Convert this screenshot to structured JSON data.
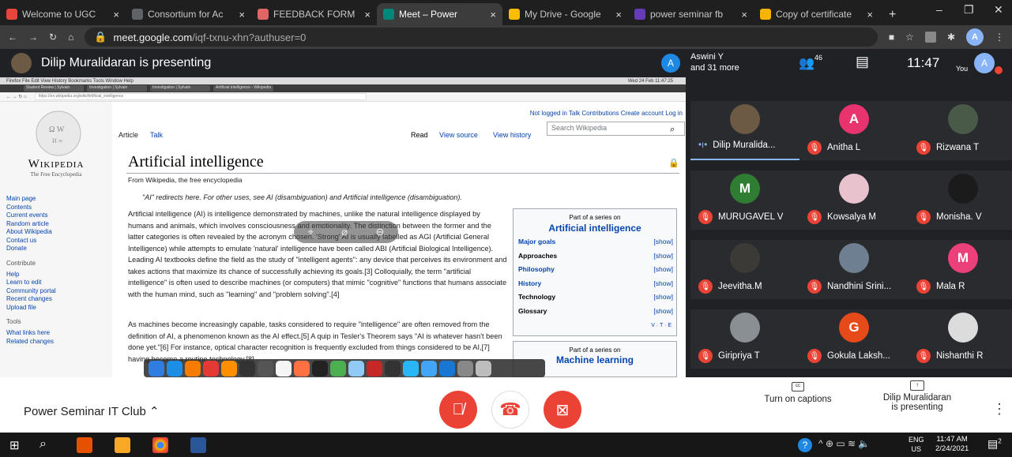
{
  "browser": {
    "tabs": [
      {
        "title": "Welcome to UGC",
        "color": "#e8453c",
        "active": false
      },
      {
        "title": "Consortium for Ac",
        "color": "#5f6368",
        "active": false
      },
      {
        "title": "FEEDBACK FORM",
        "color": "#e06666",
        "active": false
      },
      {
        "title": "Meet – Power",
        "color": "#00897b",
        "active": true
      },
      {
        "title": "My Drive - Google",
        "color": "#fbbc04",
        "active": false
      },
      {
        "title": "power seminar fb",
        "color": "#673ab7",
        "active": false
      },
      {
        "title": "Copy of certificate",
        "color": "#f4b400",
        "active": false
      }
    ],
    "new_tab": "+",
    "url_host": "meet.google.com",
    "url_path": "/iqf-txnu-xhn?authuser=0",
    "profile_initial": "A"
  },
  "meet": {
    "presenter_label": "Dilip Muralidaran is presenting",
    "viewer_initial": "A",
    "viewers_name": "Aswini Y",
    "viewers_more": "and 31 more",
    "participant_count": "46",
    "clock": "11:47",
    "you_label": "You",
    "you_initial": "A",
    "meeting_name": "Power Seminar IT Club",
    "captions_label": "Turn on captions",
    "presenting_name": "Dilip Muralidaran",
    "presenting_suffix": "is presenting"
  },
  "participants": [
    {
      "name": "Dilip Muralida...",
      "initial": "",
      "color": "#6d5a44",
      "muted": false
    },
    {
      "name": "Anitha L",
      "initial": "A",
      "color": "#e8336e",
      "muted": true
    },
    {
      "name": "Rizwana T",
      "initial": "",
      "color": "#4a5a48",
      "muted": true
    },
    {
      "name": "MURUGAVEL V",
      "initial": "M",
      "color": "#2e7d32",
      "muted": true
    },
    {
      "name": "Kowsalya M",
      "initial": "",
      "color": "#e8c2cc",
      "muted": true
    },
    {
      "name": "Monisha. V",
      "initial": "",
      "color": "#1b1b1b",
      "muted": true
    },
    {
      "name": "Jeevitha.M",
      "initial": "",
      "color": "#3b3a36",
      "muted": true
    },
    {
      "name": "Nandhini Srini...",
      "initial": "",
      "color": "#6e7f91",
      "muted": true
    },
    {
      "name": "Mala R",
      "initial": "M",
      "color": "#ec407a",
      "muted": true
    },
    {
      "name": "Giripriya T",
      "initial": "",
      "color": "#8a8f94",
      "muted": true
    },
    {
      "name": "Gokula Laksh...",
      "initial": "G",
      "color": "#e64a19",
      "muted": true
    },
    {
      "name": "Nishanthi R",
      "initial": "",
      "color": "#dcdcdc",
      "muted": true
    }
  ],
  "shared": {
    "mac_menu": "Firefox  File  Edit  View  History  Bookmarks  Tools  Window  Help",
    "mac_status": "Wed 24 Feb 11:47:25",
    "ff_tabs": [
      "Student Review | Sylvain",
      "Investigation | Sylvain",
      "Investigation | Sylvain",
      "Artificial intelligence - Wikipedia"
    ],
    "ff_url": "https://en.wikipedia.org/wiki/Artificial_intelligence",
    "wp_logo_word": "Wikipedia",
    "wp_logo_tag": "The Free Encyclopedia",
    "wp_nav": [
      "Main page",
      "Contents",
      "Current events",
      "Random article",
      "About Wikipedia",
      "Contact us",
      "Donate"
    ],
    "wp_nav_hd": "Contribute",
    "wp_nav2": [
      "Help",
      "Learn to edit",
      "Community portal",
      "Recent changes",
      "Upload file"
    ],
    "wp_nav_hd2": "Tools",
    "wp_nav3": [
      "What links here",
      "Related changes"
    ],
    "wp_userlinks": "Not logged in  Talk  Contributions  Create account  Log in",
    "wp_tab_article": "Article",
    "wp_tab_talk": "Talk",
    "wp_tab_read": "Read",
    "wp_tab_source": "View source",
    "wp_tab_history": "View history",
    "wp_search_placeholder": "Search Wikipedia",
    "wp_title": "Artificial intelligence",
    "wp_from": "From Wikipedia, the free encyclopedia",
    "wp_hatnote": "\"AI\" redirects here. For other uses, see AI (disambiguation) and Artificial intelligence (disambiguation).",
    "wp_p1": "Artificial intelligence (AI) is intelligence demonstrated by machines, unlike the natural intelligence displayed by humans and animals, which involves consciousness and emotionality. The distinction between the former and the latter categories is often revealed by the acronym chosen. 'Strong' AI is usually labelled as AGI (Artificial General Intelligence) while attempts to emulate 'natural' intelligence have been called ABI (Artificial Biological Intelligence). Leading AI textbooks define the field as the study of \"intelligent agents\": any device that perceives its environment and takes actions that maximize its chance of successfully achieving its goals.[3] Colloquially, the term \"artificial intelligence\" is often used to describe machines (or computers) that mimic \"cognitive\" functions that humans associate with the human mind, such as \"learning\" and \"problem solving\".[4]",
    "wp_p2": "As machines become increasingly capable, tasks considered to require \"intelligence\" are often removed from the definition of AI, a phenomenon known as the AI effect.[5] A quip in Tesler's Theorem says \"AI is whatever hasn't been done yet.\"[6] For instance, optical character recognition is frequently excluded from things considered to be AI,[7] having become a routine technology.[8]",
    "box_series": "Part of a series on",
    "box_title": "Artificial intelligence",
    "box_rows": [
      {
        "label": "Major goals",
        "action": "[show]"
      },
      {
        "label": "Approaches",
        "action": "[show]"
      },
      {
        "label": "Philosophy",
        "action": "[show]"
      },
      {
        "label": "History",
        "action": "[show]"
      },
      {
        "label": "Technology",
        "action": "[show]"
      },
      {
        "label": "Glossary",
        "action": "[show]"
      }
    ],
    "box_vte": "V · T · E",
    "box2_series": "Part of a series on",
    "box2_title": "Machine learning"
  },
  "taskbar": {
    "lang": "ENG",
    "region": "US",
    "time": "11:47 AM",
    "date": "2/24/2021",
    "notif": "2"
  }
}
